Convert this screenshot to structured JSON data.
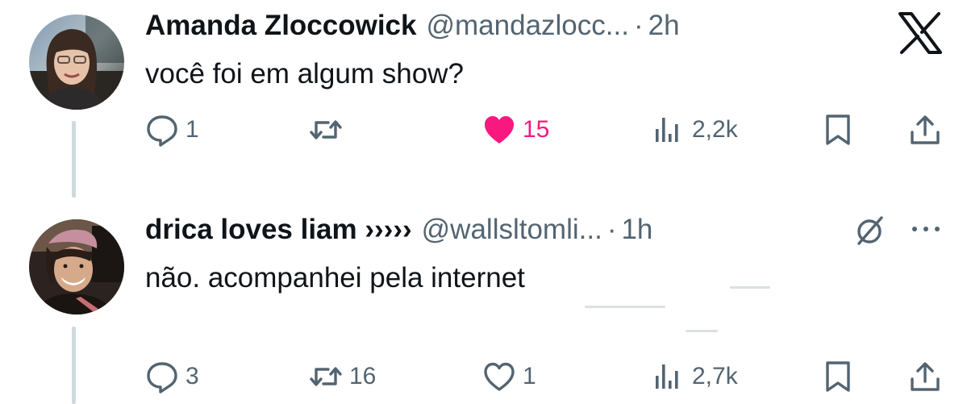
{
  "tweet1": {
    "name": "Amanda Zloccowick",
    "handle": "@mandazlocc...",
    "separator": "·",
    "time": "2h",
    "text": "você foi em algum show?",
    "replies": "1",
    "retweets": "",
    "likes": "15",
    "views": "2,2k",
    "liked": true
  },
  "tweet2": {
    "name": "drica loves liam ›››››",
    "handle": "@wallsltomli...",
    "separator": "·",
    "time": "1h",
    "text": "não. acompanhei pela internet",
    "replies": "3",
    "retweets": "16",
    "likes": "1",
    "views": "2,7k",
    "liked": false
  },
  "icons": {
    "logo": "x-logo-icon",
    "grok": "grok-icon",
    "more": "more-dots-icon"
  },
  "colors": {
    "text": "#0f1419",
    "secondary": "#536471",
    "like": "#f91880",
    "thread": "#cfd9de"
  }
}
